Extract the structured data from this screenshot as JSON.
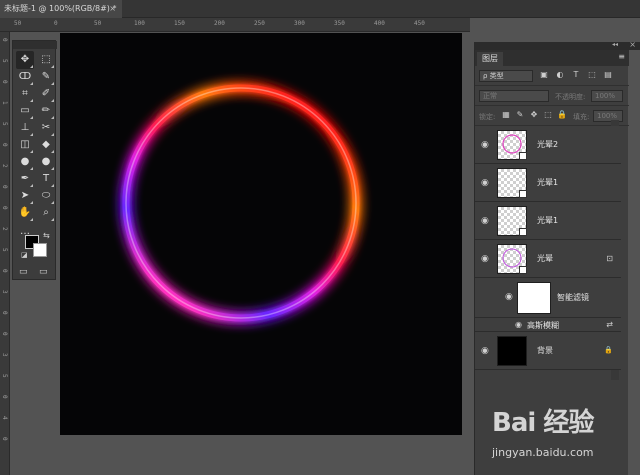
{
  "document_tab": {
    "title": "未标题-1 @ 100%(RGB/8#) *",
    "close": "×"
  },
  "ruler": {
    "top_ticks": [
      "50",
      "0",
      "50",
      "100",
      "150",
      "200",
      "250",
      "300",
      "350",
      "400",
      "450"
    ],
    "left_ticks": [
      "0",
      "5",
      "0",
      "1",
      "5",
      "0",
      "2",
      "0",
      "0",
      "2",
      "5",
      "0",
      "3",
      "0",
      "0",
      "3",
      "5",
      "0",
      "4",
      "0"
    ]
  },
  "toolbar": {
    "tools": [
      "move",
      "marquee",
      "lasso",
      "quick-select",
      "crop",
      "eyedropper",
      "frame",
      "brush",
      "stamp",
      "history-brush",
      "eraser",
      "paint-bucket",
      "blur",
      "dodge",
      "pen",
      "type",
      "path-select",
      "shape",
      "hand",
      "zoom",
      "more"
    ],
    "glyphs": [
      "✥",
      "⬚",
      "ↀ",
      "✎",
      "⌗",
      "✐",
      "▭",
      "✏",
      "⊥",
      "✂",
      "◫",
      "◆",
      "●",
      "●",
      "✒",
      "T",
      "➤",
      "⬭",
      "✋",
      "⌕",
      "…"
    ],
    "swap_glyph": "⇆",
    "default_glyph": "◪",
    "mode_glyphs": [
      "▭",
      "▭"
    ],
    "fg_color": "#000000",
    "bg_color": "#ffffff"
  },
  "canvas": {
    "background": "#050506",
    "ring_colors": [
      "#ff2020",
      "#ff7a10",
      "#ff1e50",
      "#e020e0",
      "#6a28ff",
      "#ff30c0"
    ]
  },
  "layers_panel": {
    "tab_label": "图层",
    "collapse_glyph": "◂◂",
    "close_glyph": "×",
    "menu_glyph": "≡",
    "filter_kind": "ρ 类型",
    "filter_icons": [
      "▣",
      "◐",
      "T",
      "⬚",
      "▤"
    ],
    "blend_mode": "正常",
    "opacity_label": "不透明度:",
    "opacity_value": "100%",
    "lock_label": "锁定:",
    "lock_icons": [
      "▦",
      "✎",
      "✥",
      "⬚",
      "🔒"
    ],
    "fill_label": "填充:",
    "fill_value": "100%",
    "eye_glyph": "◉",
    "smart_glyph": "⊡",
    "lock_glyph": "🔒",
    "filter_glyph": "⇄",
    "layers": [
      {
        "name": "光晕2",
        "kind": "smart"
      },
      {
        "name": "光晕1",
        "kind": "smart"
      },
      {
        "name": "光晕1",
        "kind": "smart"
      },
      {
        "name": "光晕",
        "kind": "smart-filtered"
      },
      {
        "name": "智能滤镜",
        "kind": "filter-mask"
      },
      {
        "name": "高斯模糊",
        "kind": "filter-item"
      },
      {
        "name": "背景",
        "kind": "background"
      }
    ]
  },
  "watermark": {
    "logo": "Bai 经验",
    "url": "jingyan.baidu.com"
  }
}
